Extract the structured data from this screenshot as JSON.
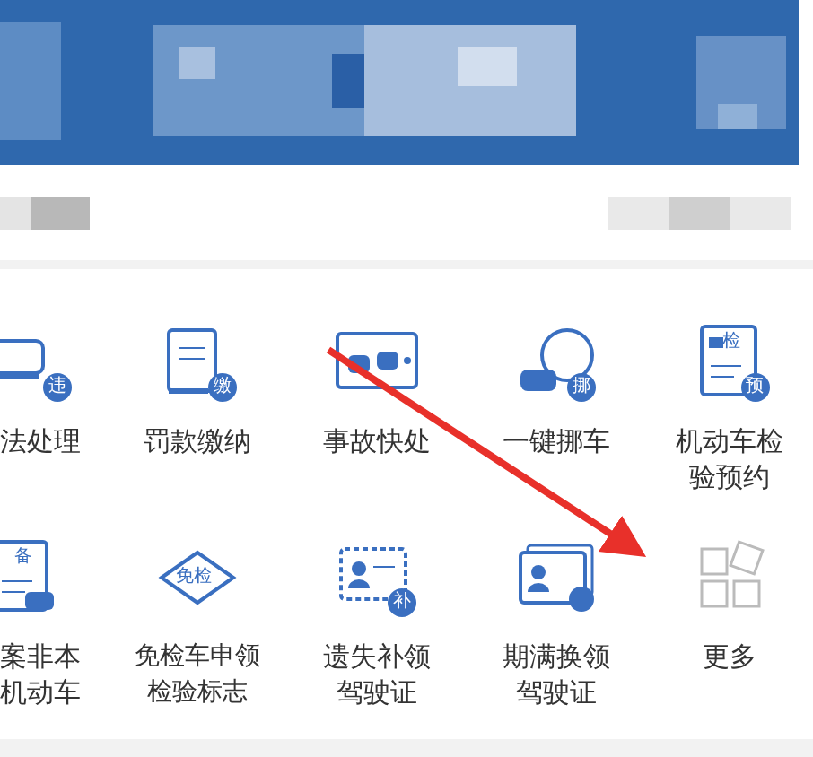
{
  "services": [
    {
      "kind": "violation",
      "label": "法处理",
      "badge": "违"
    },
    {
      "kind": "fine",
      "label": "罚款缴纳",
      "badge": "缴"
    },
    {
      "kind": "accident",
      "label": "事故快处"
    },
    {
      "kind": "move-car",
      "label": "一键挪车",
      "badge": "挪"
    },
    {
      "kind": "inspect",
      "label": "机动车检验预约",
      "badge": "预",
      "tag": "检"
    },
    {
      "kind": "record",
      "label": "案非本机动车",
      "tag": "备"
    },
    {
      "kind": "exempt",
      "label": "免检车申领检验标志",
      "tag": "免检"
    },
    {
      "kind": "lost-license",
      "label": "遗失补领驾驶证",
      "badge": "补"
    },
    {
      "kind": "renew",
      "label": "期满换领驾驶证"
    },
    {
      "kind": "more",
      "label": "更多"
    }
  ]
}
